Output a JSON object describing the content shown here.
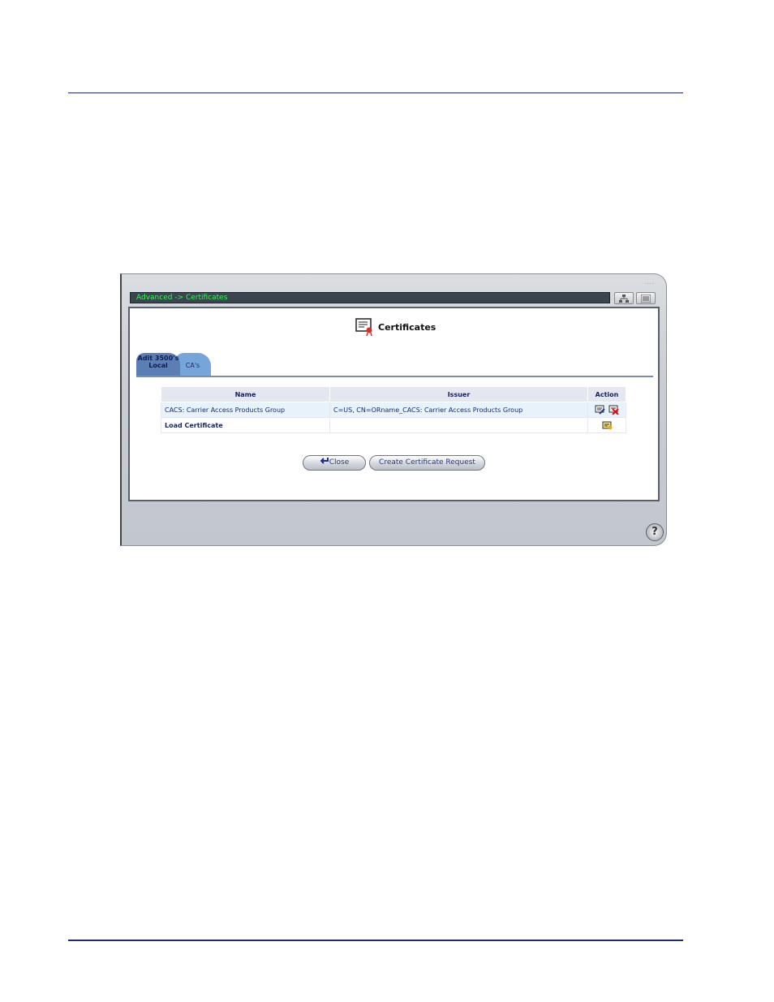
{
  "window": {
    "breadcrumb": "Advanced -> Certificates",
    "page_title": "Certificates",
    "grip_dots": "....",
    "help_glyph": "?"
  },
  "tabs": [
    {
      "label": "Adit 3500's Local",
      "active": true
    },
    {
      "label": "CA's",
      "active": false
    }
  ],
  "table": {
    "headers": [
      "Name",
      "Issuer",
      "Action"
    ],
    "rows": [
      {
        "name": "CACS: Carrier Access Products Group",
        "issuer": "C=US, CN=ORname_CACS: Carrier Access Products Group",
        "actions": [
          "edit-icon",
          "delete-icon"
        ]
      },
      {
        "name": "Load Certificate",
        "issuer": "",
        "actions": [
          "load-icon"
        ]
      }
    ]
  },
  "buttons": {
    "close": "Close",
    "create": "Create Certificate Request"
  },
  "colors": {
    "rule": "#1d2a6b",
    "breadcrumb_text": "#3df25a",
    "tab_local": "#5b7fb5",
    "tab_cas": "#77a5d9"
  }
}
